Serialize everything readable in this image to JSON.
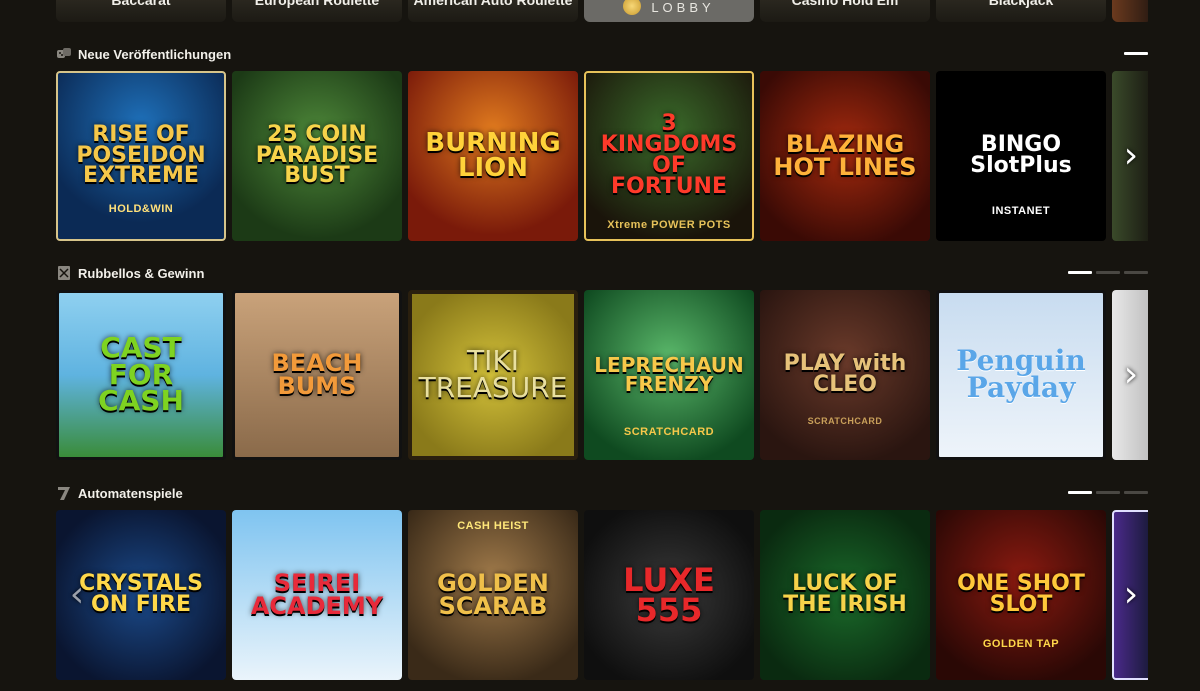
{
  "top_tabs": [
    {
      "label": "Baccarat"
    },
    {
      "label": "European Roulette"
    },
    {
      "label": "American Auto Roulette"
    },
    {
      "label": "LOBBY"
    },
    {
      "label": "Casino Hold'Em"
    },
    {
      "label": "Blackjack"
    }
  ],
  "sections": [
    {
      "title": "Neue Veröffentlichungen",
      "icon": "dice-icon",
      "tiles": [
        {
          "title": "RISE OF POSEIDON EXTREME",
          "sub": "HOLD&WIN"
        },
        {
          "title": "25 COIN PARADISE BUST",
          "sub": ""
        },
        {
          "title": "BURNING LION",
          "sub": ""
        },
        {
          "title": "3 KINGDOMS OF FORTUNE",
          "sub": "Xtreme POWER POTS"
        },
        {
          "title": "BLAZING HOT LINES",
          "sub": ""
        },
        {
          "title": "BINGO SlotPlus",
          "sub": "INSTANET"
        }
      ]
    },
    {
      "title": "Rubbellos & Gewinn",
      "icon": "scratch-card-icon",
      "tiles": [
        {
          "title": "CAST FOR CASH",
          "sub": ""
        },
        {
          "title": "BEACH BUMS",
          "sub": ""
        },
        {
          "title": "TIKI TREASURE",
          "sub": ""
        },
        {
          "title": "LEPRECHAUN FRENZY",
          "sub": "SCRATCHCARD"
        },
        {
          "title": "PLAY with CLEO",
          "sub": "SCRATCHCARD"
        },
        {
          "title": "Penguin Payday",
          "sub": ""
        }
      ]
    },
    {
      "title": "Automatenspiele",
      "icon": "seven-icon",
      "tiles": [
        {
          "title": "CRYSTALS ON FIRE",
          "sub": ""
        },
        {
          "title": "SEIREI ACADEMY",
          "sub": ""
        },
        {
          "title": "GOLDEN SCARAB",
          "sub": "CASH HEIST"
        },
        {
          "title": "LUXE 555",
          "sub": ""
        },
        {
          "title": "LUCK OF THE IRISH",
          "sub": ""
        },
        {
          "title": "ONE SHOT SLOT",
          "sub": "GOLDEN TAP"
        }
      ]
    }
  ],
  "colors": {
    "background": "#16140f",
    "tab_bg": "#2a271f",
    "lobby_bg": "#6b6a66",
    "pager_active": "#ffffff",
    "pager_inactive": "#4a4843"
  }
}
